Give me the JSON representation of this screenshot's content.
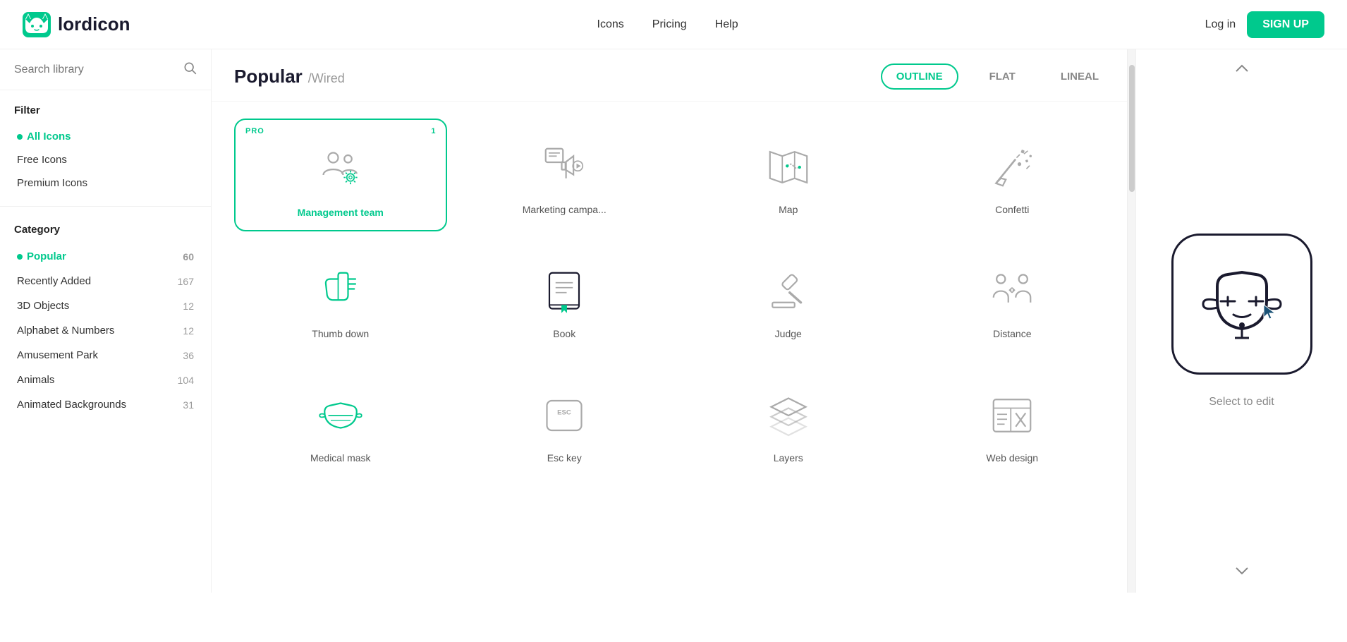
{
  "header": {
    "logo_text": "lordicon",
    "nav": {
      "icons": "Icons",
      "pricing": "Pricing",
      "help": "Help"
    },
    "login_label": "Log in",
    "signup_label": "SIGN UP"
  },
  "sidebar": {
    "search_placeholder": "Search library",
    "filter_section_title": "Filter",
    "filter_items": [
      {
        "id": "all",
        "label": "All Icons",
        "active": true
      },
      {
        "id": "free",
        "label": "Free Icons",
        "active": false
      },
      {
        "id": "premium",
        "label": "Premium Icons",
        "active": false
      }
    ],
    "category_section_title": "Category",
    "categories": [
      {
        "id": "popular",
        "label": "Popular",
        "count": "60",
        "active": true
      },
      {
        "id": "recently-added",
        "label": "Recently Added",
        "count": "167",
        "active": false
      },
      {
        "id": "3d-objects",
        "label": "3D Objects",
        "count": "12",
        "active": false
      },
      {
        "id": "alphabet-numbers",
        "label": "Alphabet & Numbers",
        "count": "12",
        "active": false
      },
      {
        "id": "amusement-park",
        "label": "Amusement Park",
        "count": "36",
        "active": false
      },
      {
        "id": "animals",
        "label": "Animals",
        "count": "104",
        "active": false
      },
      {
        "id": "animated-backgrounds",
        "label": "Animated Backgrounds",
        "count": "31",
        "active": false
      }
    ]
  },
  "content": {
    "title": "Popular",
    "subtitle": "/Wired",
    "style_filters": [
      {
        "id": "outline",
        "label": "OUTLINE",
        "active": true
      },
      {
        "id": "flat",
        "label": "FLAT",
        "active": false
      },
      {
        "id": "lineal",
        "label": "LINEAL",
        "active": false
      }
    ],
    "icons": [
      {
        "id": "management-team",
        "label": "Management team",
        "pro": true,
        "pro_num": "1",
        "active": true
      },
      {
        "id": "marketing-campaign",
        "label": "Marketing campa...",
        "pro": false,
        "active": false
      },
      {
        "id": "map",
        "label": "Map",
        "pro": false,
        "active": false
      },
      {
        "id": "confetti",
        "label": "Confetti",
        "pro": false,
        "active": false
      },
      {
        "id": "thumb-down",
        "label": "Thumb down",
        "pro": false,
        "active": false
      },
      {
        "id": "book",
        "label": "Book",
        "pro": false,
        "active": false
      },
      {
        "id": "judge",
        "label": "Judge",
        "pro": false,
        "active": false
      },
      {
        "id": "distance",
        "label": "Distance",
        "pro": false,
        "active": false
      },
      {
        "id": "medical-mask",
        "label": "Medical mask",
        "pro": false,
        "active": false
      },
      {
        "id": "esc-key",
        "label": "Esc key",
        "pro": false,
        "active": false
      },
      {
        "id": "layers",
        "label": "Layers",
        "pro": false,
        "active": false
      },
      {
        "id": "web-design",
        "label": "Web design",
        "pro": false,
        "active": false
      }
    ]
  },
  "preview": {
    "select_label": "Select to edit"
  },
  "colors": {
    "accent": "#00c98d",
    "dark": "#1a1a2e",
    "gray": "#888"
  }
}
